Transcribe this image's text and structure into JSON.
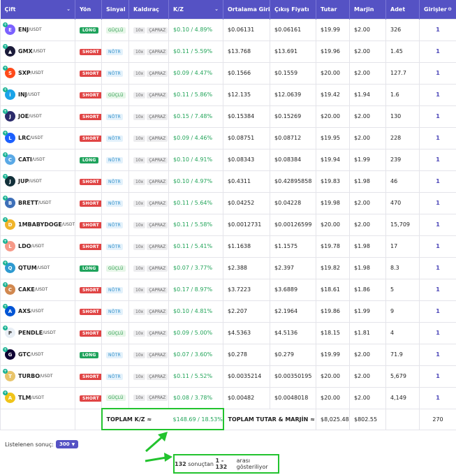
{
  "headers": [
    "Çift",
    "Yön",
    "Sinyal",
    "Kaldıraç",
    "K/Z",
    "Ortalama Giriş",
    "Çıkış Fiyatı",
    "Tutar",
    "Marjin",
    "Adet",
    "Girişler"
  ],
  "rows": [
    {
      "sym": "ENJ",
      "quote": "/USDT",
      "dir": "LONG",
      "sig": "GÜÇLÜ",
      "lev": "10x",
      "mode": "ÇAPRAZ",
      "pnl": "$0.10 / 4.89%",
      "entry": "$0.06131",
      "exit": "$0.06161",
      "amount": "$19.99",
      "margin": "$2.00",
      "qty": "326",
      "entries": "1",
      "color": "#7b61ff",
      "glyph": "E"
    },
    {
      "sym": "GMX",
      "quote": "/USDT",
      "dir": "SHORT",
      "sig": "NÖTR",
      "lev": "10x",
      "mode": "ÇAPRAZ",
      "pnl": "$0.11 / 5.59%",
      "entry": "$13.768",
      "exit": "$13.691",
      "amount": "$19.96",
      "margin": "$2.00",
      "qty": "1.45",
      "entries": "1",
      "color": "#1b1b3a",
      "glyph": "▲"
    },
    {
      "sym": "SXP",
      "quote": "/USDT",
      "dir": "SHORT",
      "sig": "NÖTR",
      "lev": "10x",
      "mode": "ÇAPRAZ",
      "pnl": "$0.09 / 4.47%",
      "entry": "$0.1566",
      "exit": "$0.1559",
      "amount": "$20.00",
      "margin": "$2.00",
      "qty": "127.7",
      "entries": "1",
      "color": "#ff4a1a",
      "glyph": "S"
    },
    {
      "sym": "INJ",
      "quote": "/USDT",
      "dir": "SHORT",
      "sig": "GÜÇLÜ",
      "lev": "10x",
      "mode": "ÇAPRAZ",
      "pnl": "$0.11 / 5.86%",
      "entry": "$12.135",
      "exit": "$12.0639",
      "amount": "$19.42",
      "margin": "$1.94",
      "qty": "1.6",
      "entries": "1",
      "color": "#1aa3e8",
      "glyph": "i"
    },
    {
      "sym": "JOE",
      "quote": "/USDT",
      "dir": "SHORT",
      "sig": "NÖTR",
      "lev": "10x",
      "mode": "ÇAPRAZ",
      "pnl": "$0.15 / 7.48%",
      "entry": "$0.15384",
      "exit": "$0.15269",
      "amount": "$20.00",
      "margin": "$2.00",
      "qty": "130",
      "entries": "1",
      "color": "#2b2b6b",
      "glyph": "J"
    },
    {
      "sym": "LRC",
      "quote": "/USDT",
      "dir": "SHORT",
      "sig": "NÖTR",
      "lev": "10x",
      "mode": "ÇAPRAZ",
      "pnl": "$0.09 / 4.46%",
      "entry": "$0.08751",
      "exit": "$0.08712",
      "amount": "$19.95",
      "margin": "$2.00",
      "qty": "228",
      "entries": "1",
      "color": "#1c60ff",
      "glyph": "L"
    },
    {
      "sym": "CATI",
      "quote": "/USDT",
      "dir": "LONG",
      "sig": "NÖTR",
      "lev": "10x",
      "mode": "ÇAPRAZ",
      "pnl": "$0.10 / 4.91%",
      "entry": "$0.08343",
      "exit": "$0.08384",
      "amount": "$19.94",
      "margin": "$1.99",
      "qty": "239",
      "entries": "1",
      "color": "#5aa9e6",
      "glyph": "C"
    },
    {
      "sym": "JUP",
      "quote": "/USDT",
      "dir": "SHORT",
      "sig": "NÖTR",
      "lev": "10x",
      "mode": "ÇAPRAZ",
      "pnl": "$0.10 / 4.97%",
      "entry": "$0.4311",
      "exit": "$0.42895858",
      "amount": "$19.83",
      "margin": "$1.98",
      "qty": "46",
      "entries": "1",
      "color": "#12303a",
      "glyph": "J"
    },
    {
      "sym": "BRETT",
      "quote": "/USDT",
      "dir": "SHORT",
      "sig": "NÖTR",
      "lev": "10x",
      "mode": "ÇAPRAZ",
      "pnl": "$0.11 / 5.64%",
      "entry": "$0.04252",
      "exit": "$0.04228",
      "amount": "$19.98",
      "margin": "$2.00",
      "qty": "470",
      "entries": "1",
      "color": "#3d6fb8",
      "glyph": "B"
    },
    {
      "sym": "1MBABYDOGE",
      "quote": "/USDT",
      "dir": "SHORT",
      "sig": "NÖTR",
      "lev": "10x",
      "mode": "ÇAPRAZ",
      "pnl": "$0.11 / 5.58%",
      "entry": "$0.0012731",
      "exit": "$0.00126599",
      "amount": "$20.00",
      "margin": "$2.00",
      "qty": "15,709",
      "entries": "1",
      "color": "#f0b429",
      "glyph": "D"
    },
    {
      "sym": "LDO",
      "quote": "/USDT",
      "dir": "SHORT",
      "sig": "NÖTR",
      "lev": "10x",
      "mode": "ÇAPRAZ",
      "pnl": "$0.11 / 5.41%",
      "entry": "$1.1638",
      "exit": "$1.1575",
      "amount": "$19.78",
      "margin": "$1.98",
      "qty": "17",
      "entries": "1",
      "color": "#f69988",
      "glyph": "L"
    },
    {
      "sym": "QTUM",
      "quote": "/USDT",
      "dir": "LONG",
      "sig": "GÜÇLÜ",
      "lev": "10x",
      "mode": "ÇAPRAZ",
      "pnl": "$0.07 / 3.77%",
      "entry": "$2.388",
      "exit": "$2.397",
      "amount": "$19.82",
      "margin": "$1.98",
      "qty": "8.3",
      "entries": "1",
      "color": "#2e9ad0",
      "glyph": "Q"
    },
    {
      "sym": "CAKE",
      "quote": "/USDT",
      "dir": "SHORT",
      "sig": "NÖTR",
      "lev": "10x",
      "mode": "ÇAPRAZ",
      "pnl": "$0.17 / 8.97%",
      "entry": "$3.7223",
      "exit": "$3.6889",
      "amount": "$18.61",
      "margin": "$1.86",
      "qty": "5",
      "entries": "1",
      "color": "#d1884f",
      "glyph": "C"
    },
    {
      "sym": "AXS",
      "quote": "/USDT",
      "dir": "SHORT",
      "sig": "NÖTR",
      "lev": "10x",
      "mode": "ÇAPRAZ",
      "pnl": "$0.10 / 4.81%",
      "entry": "$2.207",
      "exit": "$2.1964",
      "amount": "$19.86",
      "margin": "$1.99",
      "qty": "9",
      "entries": "1",
      "color": "#0055d5",
      "glyph": "A"
    },
    {
      "sym": "PENDLE",
      "quote": "/USDT",
      "dir": "SHORT",
      "sig": "GÜÇLÜ",
      "lev": "10x",
      "mode": "ÇAPRAZ",
      "pnl": "$0.09 / 5.00%",
      "entry": "$4.5363",
      "exit": "$4.5136",
      "amount": "$18.15",
      "margin": "$1.81",
      "qty": "4",
      "entries": "1",
      "color": "#e8eef5",
      "glyph": "P"
    },
    {
      "sym": "GTC",
      "quote": "/USDT",
      "dir": "LONG",
      "sig": "NÖTR",
      "lev": "10x",
      "mode": "ÇAPRAZ",
      "pnl": "$0.07 / 3.60%",
      "entry": "$0.278",
      "exit": "$0.279",
      "amount": "$19.99",
      "margin": "$2.00",
      "qty": "71.9",
      "entries": "1",
      "color": "#0e0333",
      "glyph": "G"
    },
    {
      "sym": "TURBO",
      "quote": "/USDT",
      "dir": "SHORT",
      "sig": "NÖTR",
      "lev": "10x",
      "mode": "ÇAPRAZ",
      "pnl": "$0.11 / 5.52%",
      "entry": "$0.0035214",
      "exit": "$0.00350195",
      "amount": "$20.00",
      "margin": "$2.00",
      "qty": "5,679",
      "entries": "1",
      "color": "#e8c46a",
      "glyph": "T"
    },
    {
      "sym": "TLM",
      "quote": "/USDT",
      "dir": "SHORT",
      "sig": "GÜÇLÜ",
      "lev": "10x",
      "mode": "ÇAPRAZ",
      "pnl": "$0.08 / 3.78%",
      "entry": "$0.00482",
      "exit": "$0.0048018",
      "amount": "$20.00",
      "margin": "$2.00",
      "qty": "4,149",
      "entries": "1",
      "color": "#f0c419",
      "glyph": "A"
    }
  ],
  "totals": {
    "pnl_label": "TOPLAM K/Z ≈",
    "pnl_value": "$148.69 / 18.53%",
    "amount_label": "TOPLAM TUTAR & MARJİN ≈",
    "amount_value": "$8,025.48",
    "margin_value": "$802.55",
    "entries_value": "270"
  },
  "footer": {
    "listed_label": "Listelenen sonuç:",
    "page_size": "300",
    "showing_total": "132",
    "showing_mid": "sonuçtan",
    "showing_range": "1 - 132",
    "showing_tail": "arası gösteriliyor"
  },
  "colors": {
    "header": "#5552c4",
    "long": "#1fa35c",
    "short": "#e04444",
    "pnl": "#23a55a",
    "highlight": "#22c32e"
  }
}
